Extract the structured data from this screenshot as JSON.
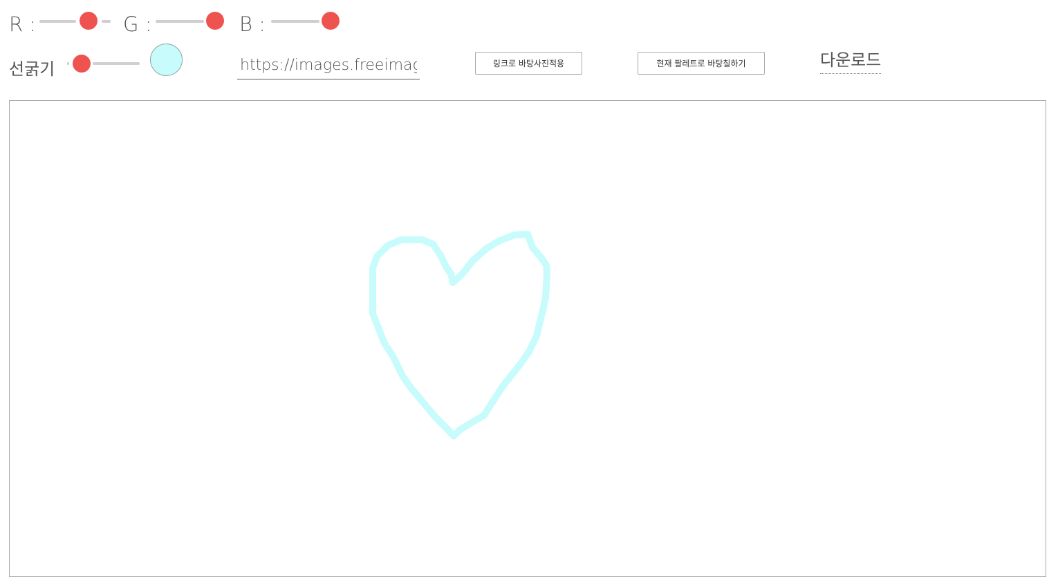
{
  "controls": {
    "r_label": "R :",
    "g_label": "G :",
    "b_label": "B :",
    "thickness_label": "선굵기",
    "thumb_color": "#ef5350",
    "track_color": "#cfcfcf",
    "red_value": 192,
    "green_value": 255,
    "blue_value": 255,
    "thickness_value_fraction": 0.1
  },
  "current_color": "#c8fbfb",
  "url_input": {
    "value": "https://images.freeimages"
  },
  "buttons": {
    "apply_link_background": "링크로 바탕사진적용",
    "fill_background_palette": "현재 팔레트로 바탕칠하기"
  },
  "download_label": "다운로드",
  "canvas": {
    "stroke_color": "#c8fbfb",
    "shape": "heart-icon"
  }
}
